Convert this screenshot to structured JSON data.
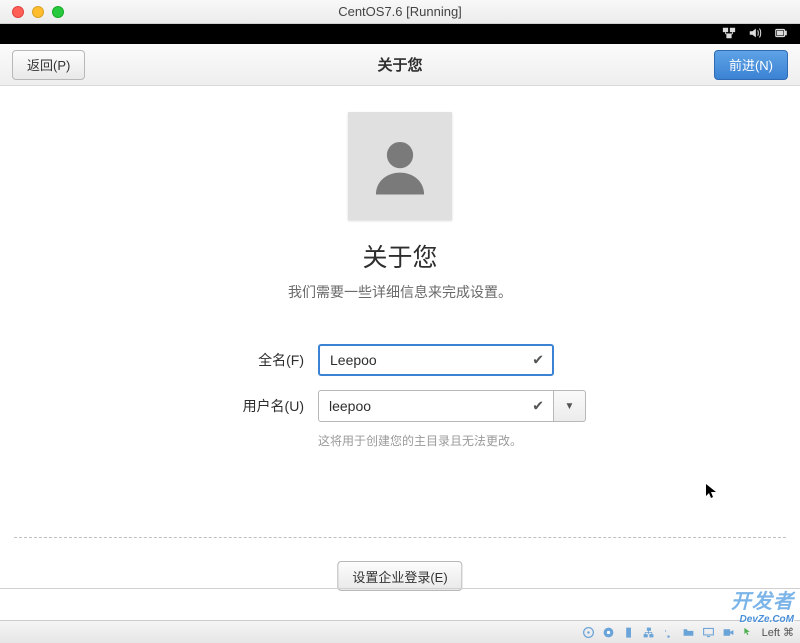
{
  "window": {
    "title": "CentOS7.6 [Running]"
  },
  "header": {
    "back_label": "返回(P)",
    "title": "关于您",
    "forward_label": "前进(N)"
  },
  "main": {
    "title": "关于您",
    "subtitle": "我们需要一些详细信息来完成设置。"
  },
  "form": {
    "full_name": {
      "label": "全名(F)",
      "value": "Leepoo"
    },
    "username": {
      "label": "用户名(U)",
      "value": "leepoo",
      "hint": "这将用于创建您的主目录且无法更改。"
    }
  },
  "footer": {
    "enterprise_label": "设置企业登录(E)"
  },
  "statusbar": {
    "host_key": "Left ⌘"
  },
  "watermark": {
    "line1": "开发者",
    "line2": "DevZe.CoM"
  },
  "icons": {
    "network": "network-icon",
    "volume": "volume-icon",
    "battery": "battery-icon",
    "user": "user-icon",
    "check": "check-icon",
    "dropdown": "chevron-down-icon"
  }
}
